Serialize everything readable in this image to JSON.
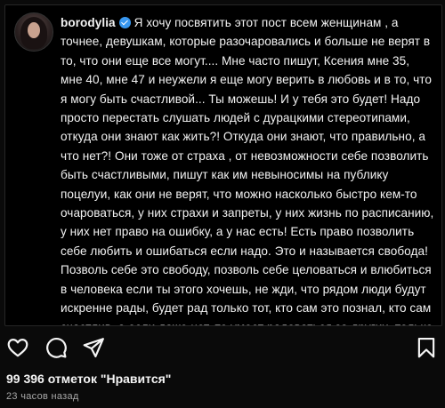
{
  "post": {
    "username": "borodylia",
    "verified": true,
    "caption": "Я хочу посвятить этот пост всем женщинам , а точнее, девушкам, которые разочаровались и больше не верят в то, что они еще все могут.... Мне часто пишут, Ксения мне 35, мне 40, мне 47 и неужели я еще могу верить в любовь и в то, что я могу быть счастливой... Ты можешь! И у тебя это будет! Надо просто перестать слушать людей с дурацкими стереотипами, откуда они знают как жить?! Откуда они знают, что правильно, а что нет?! Они тоже от страха , от невозможности себе позволить быть счастливыми, пишут как им невыносимы на публику поцелуи, как они не верят, что можно насколько быстро кем-то очароваться, у них страхи и запреты, у них жизнь по расписанию, у них нет право на ошибку, а у нас есть! Есть право позволить себе любить и ошибаться если надо. Это и называется свобода! Позволь себе это свободу, позволь себе целоваться и влюбиться в человека если ты этого хочешь, не жди, что рядом люди будут искренне рады, будет рад только тот, кто сам это познал, кто сам счастлив, а если даже нет, то умеет радоваться за других, только у таких светлая душа и сердце"
  },
  "actions": {
    "like_icon": "heart-outline-icon",
    "comment_icon": "comment-bubble-icon",
    "share_icon": "paper-plane-icon",
    "save_icon": "bookmark-icon"
  },
  "stats": {
    "likes_text": "99 396 отметок \"Нравится\"",
    "time_text": "23 часов назад"
  }
}
